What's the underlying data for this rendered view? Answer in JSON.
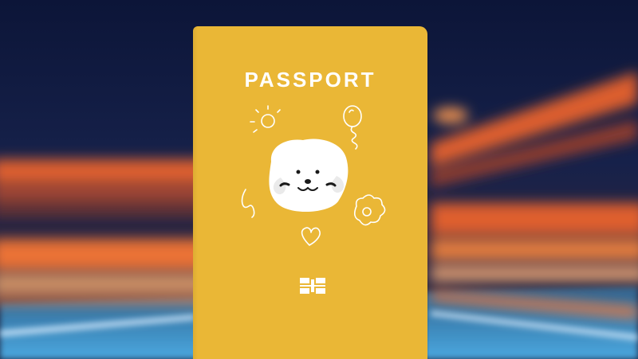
{
  "passport": {
    "title": "PASSPORT",
    "cover_color": "#eab736",
    "icons": [
      "sun-icon",
      "balloon-icon",
      "dog-face-icon",
      "squiggle-icon",
      "flower-icon",
      "heart-icon",
      "chip-icon"
    ]
  },
  "background": {
    "description_colors": [
      "#0f1b3f",
      "#ff6a2a",
      "#4aa3d8"
    ]
  }
}
